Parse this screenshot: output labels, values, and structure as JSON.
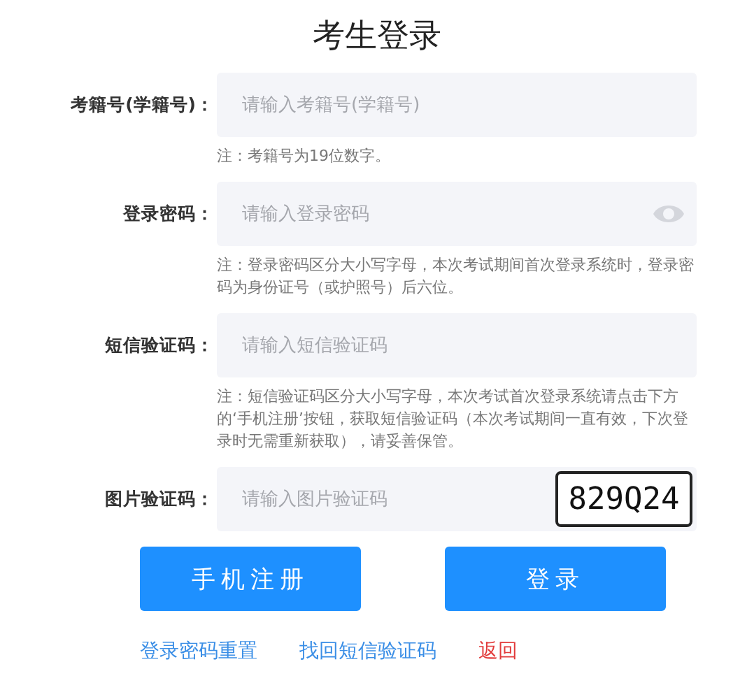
{
  "title": "考生登录",
  "fields": [
    {
      "kind": "text",
      "label": "考籍号(学籍号)：",
      "placeholder": "请输入考籍号(学籍号)",
      "note": "注：考籍号为19位数字。"
    },
    {
      "kind": "password",
      "label": "登录密码：",
      "placeholder": "请输入登录密码",
      "note": "注：登录密码区分大小写字母，本次考试期间首次登录系统时，登录密码为身份证号（或护照号）后六位。"
    },
    {
      "kind": "text",
      "label": "短信验证码：",
      "placeholder": "请输入短信验证码",
      "note": "注：短信验证码区分大小写字母，本次考试首次登录系统请点击下方的‘手机注册’按钮，获取短信验证码（本次考试期间一直有效，下次登录时无需重新获取），请妥善保管。"
    },
    {
      "kind": "captcha",
      "label": "图片验证码：",
      "placeholder": "请输入图片验证码",
      "captcha": "829Q24"
    }
  ],
  "buttons": [
    "手机注册",
    "登录"
  ],
  "links": [
    {
      "label": "登录密码重置",
      "color": "#3a8ee6"
    },
    {
      "label": "找回短信验证码",
      "color": "#3a8ee6"
    },
    {
      "label": "返回",
      "color": "#e23b3b"
    }
  ]
}
